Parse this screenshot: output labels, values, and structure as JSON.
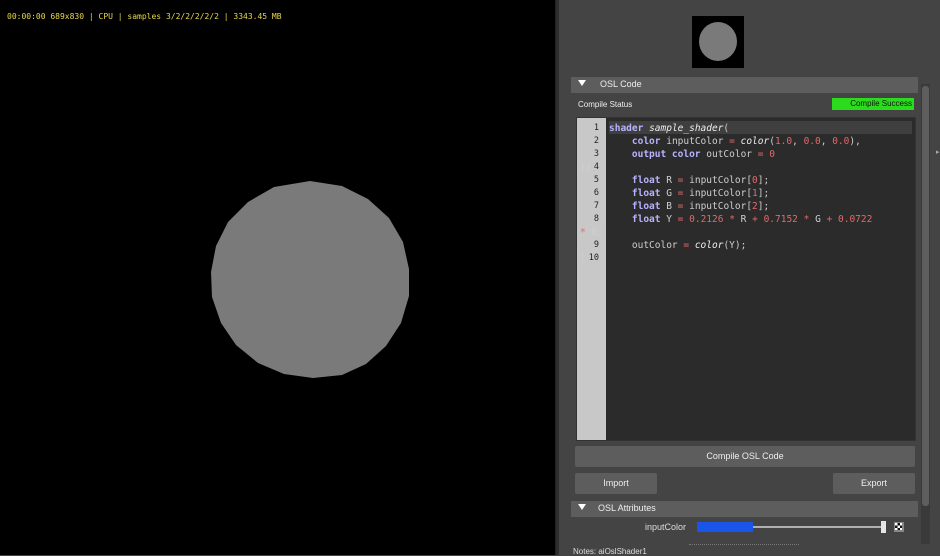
{
  "viewport": {
    "status_line": "00:00:00 689x830 | CPU | samples 3/2/2/2/2/2 | 3343.45 MB",
    "background": "#000000",
    "sphere_color": "#7a7a7a"
  },
  "osl_code_frame": {
    "title": "OSL Code",
    "compile_status_label": "Compile Status",
    "compile_status_value": "Compile Success",
    "compile_status_color": "#2bdc1c"
  },
  "code": {
    "line_numbers": [
      "1",
      "2",
      "3",
      "4",
      "5",
      "6",
      "7",
      "8",
      "",
      "9",
      "10"
    ]
  },
  "buttons": {
    "compile": "Compile OSL Code",
    "import": "Import",
    "export": "Export"
  },
  "osl_attributes_frame": {
    "title": "OSL Attributes",
    "input_color_label": "inputColor",
    "input_color": "#1a55ea"
  },
  "notes": {
    "label": "Notes: aiOslShader1"
  },
  "icons": [
    "collapse-arrow-icon",
    "checker-map-icon"
  ]
}
